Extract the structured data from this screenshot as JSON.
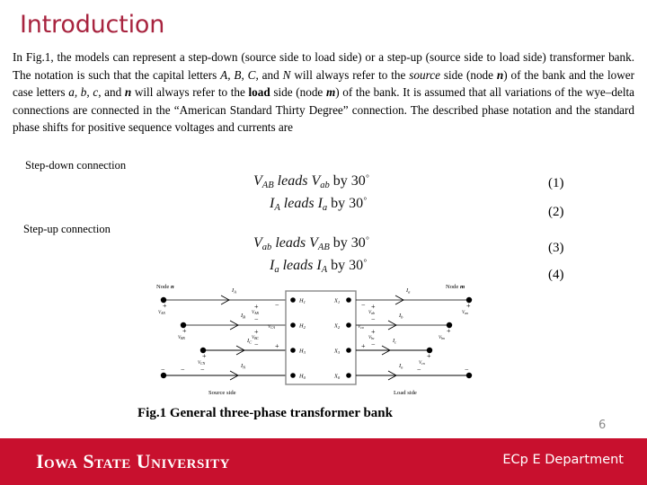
{
  "slide": {
    "title": "Introduction",
    "page_number": "6",
    "accent_color": "#c8102e",
    "title_color": "#a8243f"
  },
  "body": {
    "paragraph_runs": [
      {
        "text": "In Fig.1, the models can represent a step-down (source side to load side) or a step-up (source side to load side) transformer bank. The notation is such that the capital letters ",
        "style": "normal"
      },
      {
        "text": "A, B, C,",
        "style": "italic"
      },
      {
        "text": " and ",
        "style": "normal"
      },
      {
        "text": "N",
        "style": "italic"
      },
      {
        "text": " will always refer to the ",
        "style": "normal"
      },
      {
        "text": "source",
        "style": "italic"
      },
      {
        "text": " side (node ",
        "style": "normal"
      },
      {
        "text": "n",
        "style": "bold-italic"
      },
      {
        "text": ") of the bank and the lower case letters ",
        "style": "normal"
      },
      {
        "text": "a, b, c",
        "style": "italic"
      },
      {
        "text": ", and ",
        "style": "normal"
      },
      {
        "text": "n",
        "style": "bold-italic"
      },
      {
        "text": " will always refer to the ",
        "style": "normal"
      },
      {
        "text": "load",
        "style": "bold"
      },
      {
        "text": " side (node ",
        "style": "normal"
      },
      {
        "text": "m",
        "style": "bold-italic"
      },
      {
        "text": ") of the bank. It is assumed that all variations of the wye–delta connections are connected in the “American Standard Thirty Degree” connection. The described phase notation and the standard phase shifts for positive sequence voltages and currents are",
        "style": "normal"
      }
    ]
  },
  "sections": {
    "stepdown_label": "Step-down connection",
    "stepup_label": "Step-up connection"
  },
  "equations": [
    {
      "number": "(1)",
      "lead": "V",
      "lead_sub": "AB",
      "verb": "leads",
      "lag": "V",
      "lag_sub": "ab",
      "by": "by",
      "angle": "30",
      "deg": "°"
    },
    {
      "number": "(2)",
      "lead": "I",
      "lead_sub": "A",
      "verb": "leads",
      "lag": "I",
      "lag_sub": "a",
      "by": "by",
      "angle": "30",
      "deg": "°"
    },
    {
      "number": "(3)",
      "lead": "V",
      "lead_sub": "ab",
      "verb": "leads",
      "lag": "V",
      "lag_sub": "AB",
      "by": "by",
      "angle": "30",
      "deg": "°"
    },
    {
      "number": "(4)",
      "lead": "I",
      "lead_sub": "a",
      "verb": "leads",
      "lag": "I",
      "lag_sub": "A",
      "by": "by",
      "angle": "30",
      "deg": "°"
    }
  ],
  "figure": {
    "caption": "Fig.1 General three-phase transformer bank",
    "source_node": "Node n",
    "load_node": "Node m",
    "source_side": "Source side",
    "load_side": "Load side",
    "source_currents": [
      "IA",
      "IB",
      "IC",
      "IN"
    ],
    "load_currents": [
      "Ia",
      "Ib",
      "Ic",
      "In"
    ],
    "source_phase_voltages": [
      "VAN",
      "VBN",
      "VCN"
    ],
    "source_line_voltages": [
      "VAB",
      "VBC",
      "VCA"
    ],
    "load_phase_voltages": [
      "Van",
      "Vbn",
      "Vcn"
    ],
    "load_line_voltages": [
      "Vab",
      "Vbc",
      "Vca"
    ],
    "primary_terminals": [
      "H1",
      "H2",
      "H3",
      "H0"
    ],
    "secondary_terminals": [
      "X1",
      "X2",
      "X3",
      "X0"
    ]
  },
  "footer": {
    "logo_text": "Iowa State University",
    "department": "ECp E Department"
  }
}
